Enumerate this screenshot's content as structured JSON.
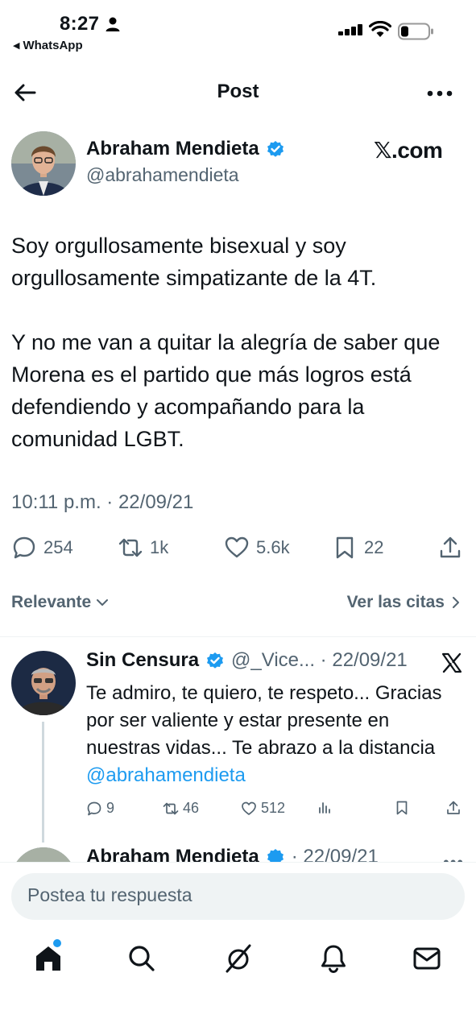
{
  "status_bar": {
    "time": "8:27",
    "back_app": "WhatsApp"
  },
  "header": {
    "title": "Post"
  },
  "tweet": {
    "author_name": "Abraham Mendieta",
    "handle": "@abrahamendieta",
    "site": "𝕏.com",
    "text": "Soy orgullosamente bisexual y soy orgullosamente simpatizante de la 4T.\n\nY no me van a quitar la alegría de saber que Morena es el partido que más logros está defendiendo y acompañando para la comunidad LGBT.",
    "timestamp": "10:11 p.m. · 22/09/21",
    "replies": "254",
    "reposts": "1k",
    "likes": "5.6k",
    "bookmarks": "22"
  },
  "filter": {
    "sort_label": "Relevante",
    "quotes_label": "Ver las citas"
  },
  "reply": {
    "author_name": "Sin Censura",
    "meta": "@_Vice... · 22/09/21",
    "text": "Te admiro, te quiero, te respeto... Gracias por ser valiente y estar presente en nuestras vidas... Te abrazo a la distancia ",
    "mention": "@abrahamendieta",
    "replies": "9",
    "reposts": "46",
    "likes": "512"
  },
  "next_reply": {
    "author_name": "Abraham Mendieta",
    "meta": "· 22/09/21"
  },
  "composer": {
    "placeholder": "Postea tu respuesta"
  },
  "colors": {
    "accent": "#1d9bf0",
    "secondary_text": "#536471",
    "primary_text": "#0f1419"
  },
  "icons": {
    "nav": [
      "home-icon",
      "search-icon",
      "grok-icon",
      "notifications-icon",
      "messages-icon"
    ]
  }
}
